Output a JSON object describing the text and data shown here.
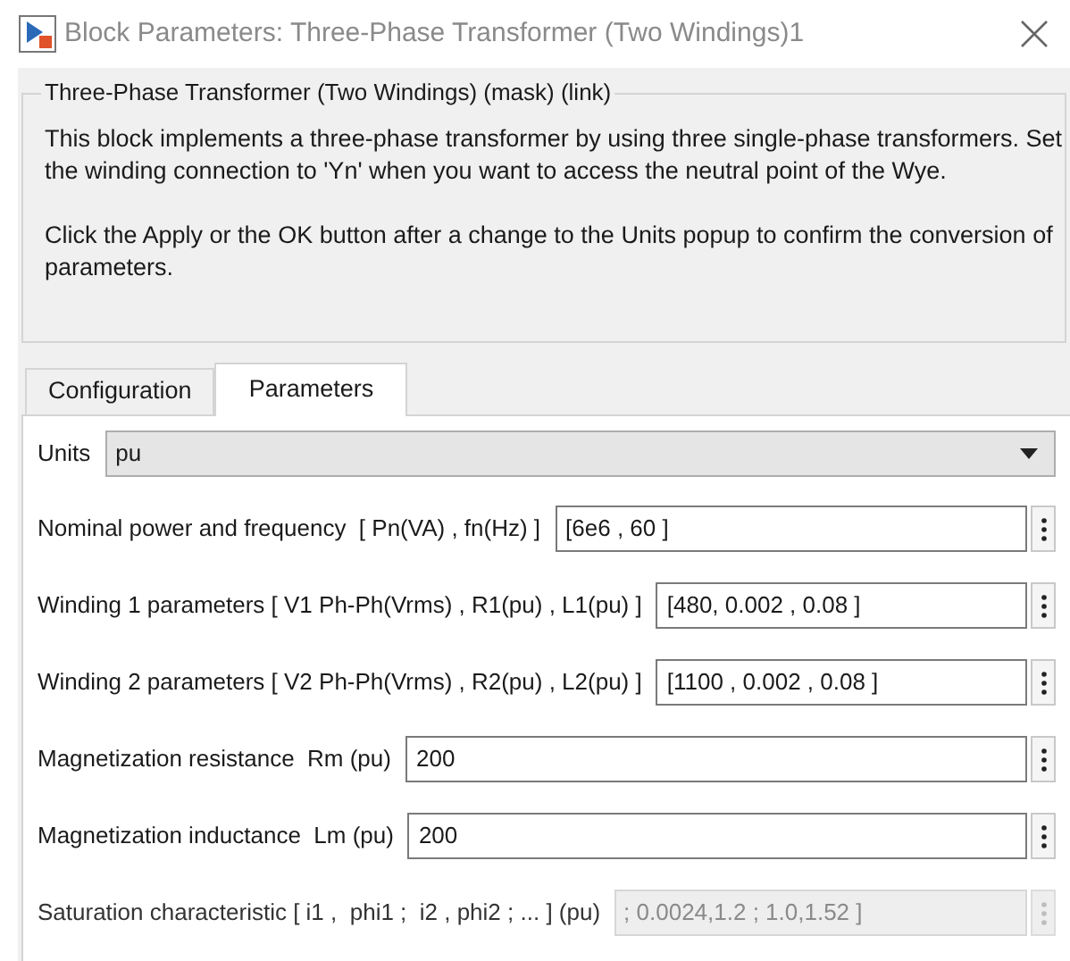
{
  "window": {
    "title": "Block Parameters: Three-Phase Transformer (Two Windings)1"
  },
  "description": {
    "title": "Three-Phase Transformer (Two Windings) (mask) (link)",
    "paragraphs": [
      "This block implements a three-phase transformer by using three single-phase transformers. Set the winding connection to 'Yn'  when you want to access the neutral point of the Wye.",
      "Click the Apply or the OK button after a change to the Units popup to confirm the conversion of parameters."
    ]
  },
  "tabs": [
    {
      "label": "Configuration",
      "selected": false
    },
    {
      "label": "Parameters",
      "selected": true
    }
  ],
  "units": {
    "label": "Units",
    "value": "pu"
  },
  "parameters": [
    {
      "label": "Nominal power and frequency  [ Pn(VA) , fn(Hz) ]",
      "value": "[6e6 , 60 ]",
      "disabled": false
    },
    {
      "label": "Winding 1 parameters [ V1 Ph-Ph(Vrms) , R1(pu) , L1(pu) ]",
      "value": "[480, 0.002 , 0.08 ]",
      "disabled": false
    },
    {
      "label": "Winding 2 parameters [ V2 Ph-Ph(Vrms) , R2(pu) , L2(pu) ]",
      "value": "[1100 , 0.002 , 0.08 ]",
      "disabled": false
    },
    {
      "label": "Magnetization resistance  Rm (pu)",
      "value": "200",
      "disabled": false
    },
    {
      "label": "Magnetization inductance  Lm (pu)",
      "value": "200",
      "disabled": false
    },
    {
      "label": "Saturation characteristic [ i1 ,  phi1 ;  i2 , phi2 ; ... ] (pu)",
      "value": "; 0.0024,1.2 ; 1.0,1.52 ]",
      "disabled": true
    }
  ]
}
